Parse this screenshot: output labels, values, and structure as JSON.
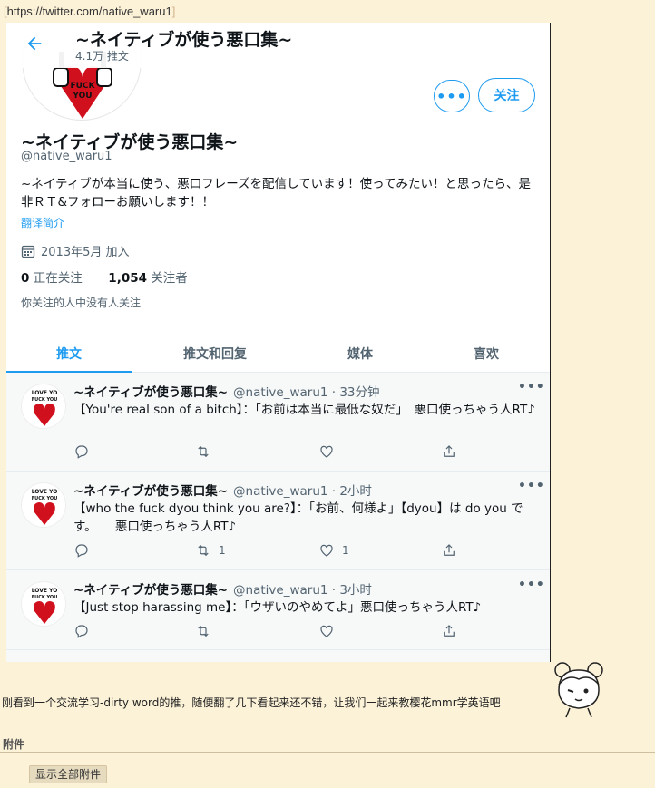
{
  "url": "https://twitter.com/native_waru1",
  "profile": {
    "name": "~ネイティブが使う悪口集~",
    "tweet_count": "4.1万 推文",
    "handle": "@native_waru1",
    "bio": "~ネイティブが本当に使う、悪口フレーズを配信しています！使ってみたい！と思ったら、是非ＲＴ&フォローお願いします！！",
    "translate": "翻译简介",
    "joined": "2013年5月 加入",
    "following_count": "0",
    "following_label": "正在关注",
    "followers_count": "1,054",
    "followers_label": "关注者",
    "no_followers_known": "你关注的人中没有人关注",
    "follow_label": "关注",
    "more_label": "•••"
  },
  "tabs": [
    "推文",
    "推文和回复",
    "媒体",
    "喜欢"
  ],
  "tweets": [
    {
      "name": "~ネイティブが使う悪口集~",
      "handle": "@native_waru1 · 33分钟",
      "text": "【You're real son of a bitch】：「お前は本当に最低な奴だ」　悪口使っちゃう人RT♪",
      "retweets": "",
      "likes": ""
    },
    {
      "name": "~ネイティブが使う悪口集~",
      "handle": "@native_waru1 · 2小时",
      "text": "【who the fuck dyou think you are?】：「お前、何様よ」【dyou】は do you です。　　悪口使っちゃう人RT♪",
      "retweets": "1",
      "likes": "1"
    },
    {
      "name": "~ネイティブが使う悪口集~",
      "handle": "@native_waru1 · 3小时",
      "text": "【Just stop harassing me】：「ウザいのやめてよ」悪口使っちゃう人RT♪",
      "retweets": "",
      "likes": ""
    }
  ],
  "tweet_more": "•••",
  "caption": "刚看到一个交流学习-dirty word的推，随便翻了几下看起来还不错，让我们一起来教樱花mmr学英语吧",
  "attachments_label": "附件",
  "show_all_attachments": "显示全部附件",
  "colors": {
    "accent": "#1d9bf0",
    "page_bg": "#fcf2d8",
    "tweet_bg": "#f7f9f9"
  }
}
